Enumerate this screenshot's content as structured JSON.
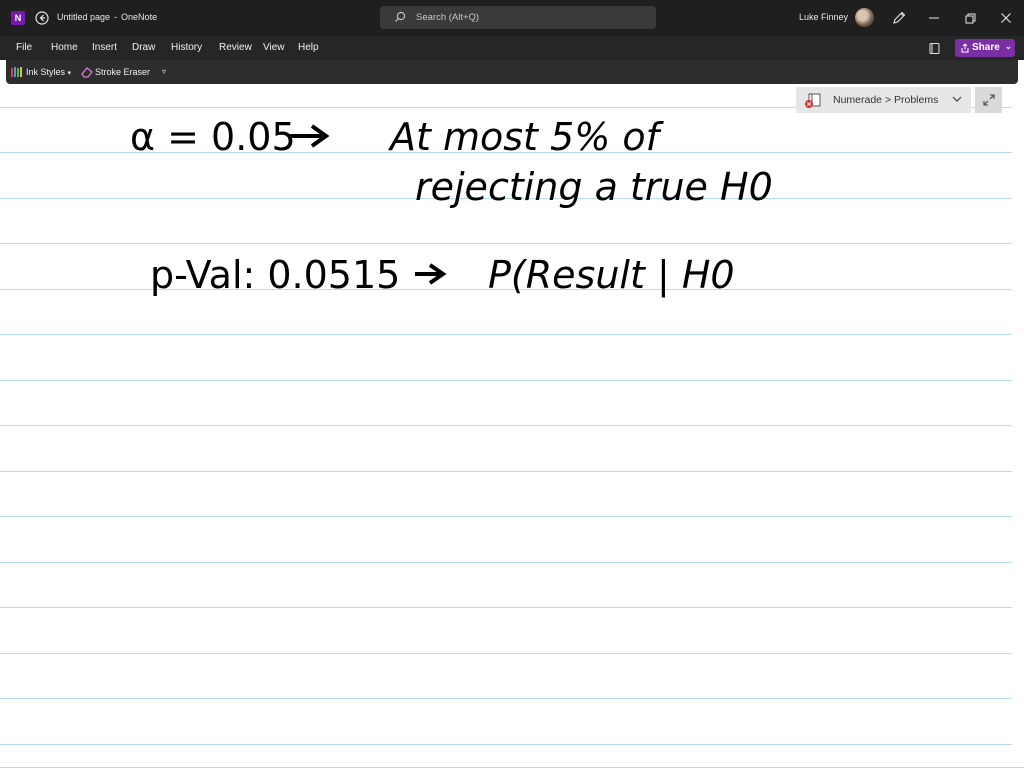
{
  "window": {
    "page_title": "Untitled page",
    "separator": "-",
    "app_name": "OneNote",
    "search_placeholder": "Search (Alt+Q)",
    "user_name": "Luke Finney"
  },
  "menu": {
    "items": [
      "File",
      "Home",
      "Insert",
      "Draw",
      "History",
      "Review",
      "View",
      "Help"
    ],
    "share_label": "Share"
  },
  "ribbon": {
    "ink_styles": "Ink Styles",
    "stroke_eraser": "Stroke Eraser"
  },
  "breadcrumb": {
    "path": "Numerade > Problems"
  },
  "ink_notes": {
    "line1_left": "α = 0.05",
    "line1_right": "At most 5% of",
    "line2": "rejecting a true H0",
    "line3_left": "p-Val: 0.0515",
    "line3_right": "P(Result | H0"
  },
  "colors": {
    "titlebar": "#1f1f1f",
    "accent": "#7b2fa5",
    "rule_line": "#b8dff0"
  }
}
